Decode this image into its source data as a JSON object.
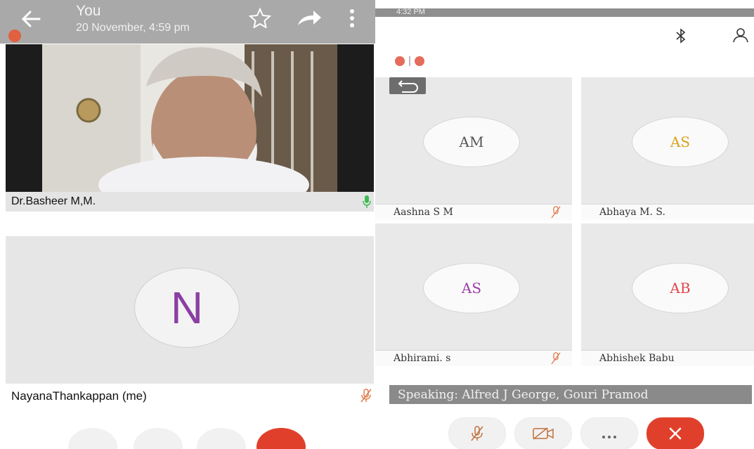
{
  "left": {
    "header": {
      "title": "You",
      "subtitle": "20 November, 4:59 pm"
    },
    "video_tile": {
      "name": "Dr.Basheer M,M."
    },
    "self_tile": {
      "initial": "N",
      "name": "NayanaThankappan (me)"
    }
  },
  "right": {
    "status": {
      "time": "4:32 PM"
    },
    "participants": [
      {
        "initials": "AM",
        "name": "Aashna S M",
        "color": "#555555"
      },
      {
        "initials": "AS",
        "name": "Abhaya M. S.",
        "color": "#d9a21b"
      },
      {
        "initials": "AS",
        "name": "Abhirami. s",
        "color": "#9b3ea8"
      },
      {
        "initials": "AB",
        "name": "Abhishek Babu",
        "color": "#e0474c"
      }
    ],
    "speaking": "Speaking: Alfred J George, Gouri Pramod"
  },
  "colors": {
    "accent_red": "#e0402b",
    "mic_green": "#3cba54"
  },
  "icons": [
    "back-arrow-icon",
    "star-icon",
    "share-icon",
    "more-vert-icon",
    "mic-icon",
    "mic-off-icon",
    "bluetooth-icon",
    "switch-camera-icon",
    "exit-fullscreen-icon",
    "video-off-icon",
    "more-horiz-icon",
    "end-call-icon"
  ]
}
